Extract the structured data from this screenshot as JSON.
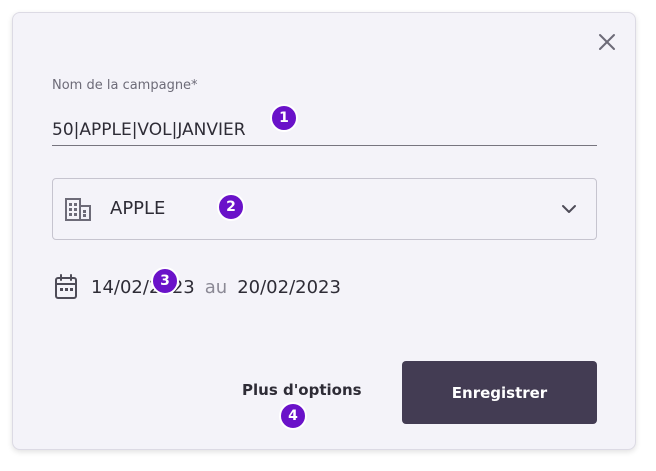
{
  "dialog": {
    "close_icon": "close-icon",
    "name_field": {
      "label": "Nom de la campagne*",
      "value": "50|APPLE|VOL|JANVIER"
    },
    "company_select": {
      "icon": "building-icon",
      "value": "APPLE",
      "chevron_icon": "chevron-down-icon"
    },
    "dates": {
      "icon": "calendar-icon",
      "start": "14/02/2023",
      "separator": "au",
      "end": "20/02/2023"
    },
    "more_options_label": "Plus d'options",
    "save_label": "Enregistrer"
  },
  "annotations": {
    "badge_1": "1",
    "badge_2": "2",
    "badge_3": "3",
    "badge_4": "4",
    "color": "#6a12c9"
  },
  "colors": {
    "dialog_bg": "#f4f3f9",
    "primary_button": "#433c53"
  }
}
